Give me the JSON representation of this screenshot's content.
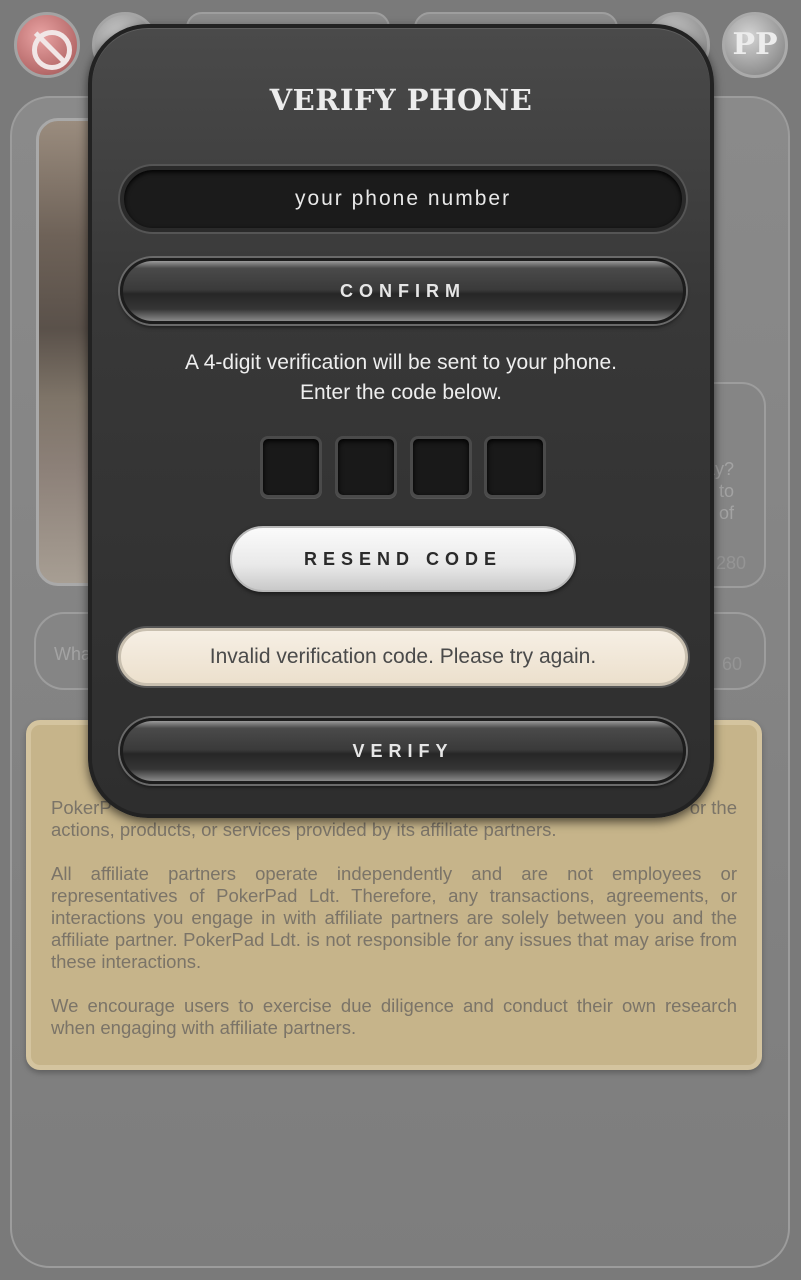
{
  "modal": {
    "title": "VERIFY PHONE",
    "phone_placeholder": "your phone number",
    "confirm_label": "CONFIRM",
    "info_line1": "A  4-digit verification will be sent to  your phone.",
    "info_line2": "Enter the code below.",
    "code_digits": [
      "",
      "",
      "",
      ""
    ],
    "resend_label": "RESEND CODE",
    "error_message": "Invalid verification code. Please try again.",
    "verify_label": "VERIFY"
  },
  "background": {
    "logo_text": "PP",
    "right_card_line1": "ay?",
    "right_card_line2": "to",
    "right_card_line3": "of",
    "right_card_number": "280",
    "row_left_text": "Wha",
    "row_right_number": "60",
    "disclaimer": {
      "p1_start": "PokerP",
      "p1_end": "or the",
      "p1_line2": "actions, products, or services provided by its affiliate partners.",
      "p2": "All affiliate partners operate independently and are not employees or representatives of PokerPad Ldt. Therefore, any transactions, agreements, or interactions you engage in with affiliate partners are solely between you and the affiliate partner. PokerPad Ldt. is not responsible for any issues that may arise from these interactions.",
      "p3": "We encourage users to exercise due diligence and conduct their own research when engaging with affiliate partners."
    }
  },
  "colors": {
    "modal_bg": "#383838",
    "error_bg": "#f3eadc",
    "disclaimer_bg": "#c6b48a",
    "block_button": "#b66a6a"
  },
  "icons": [
    "block-icon",
    "pokerpad-logo-icon"
  ]
}
